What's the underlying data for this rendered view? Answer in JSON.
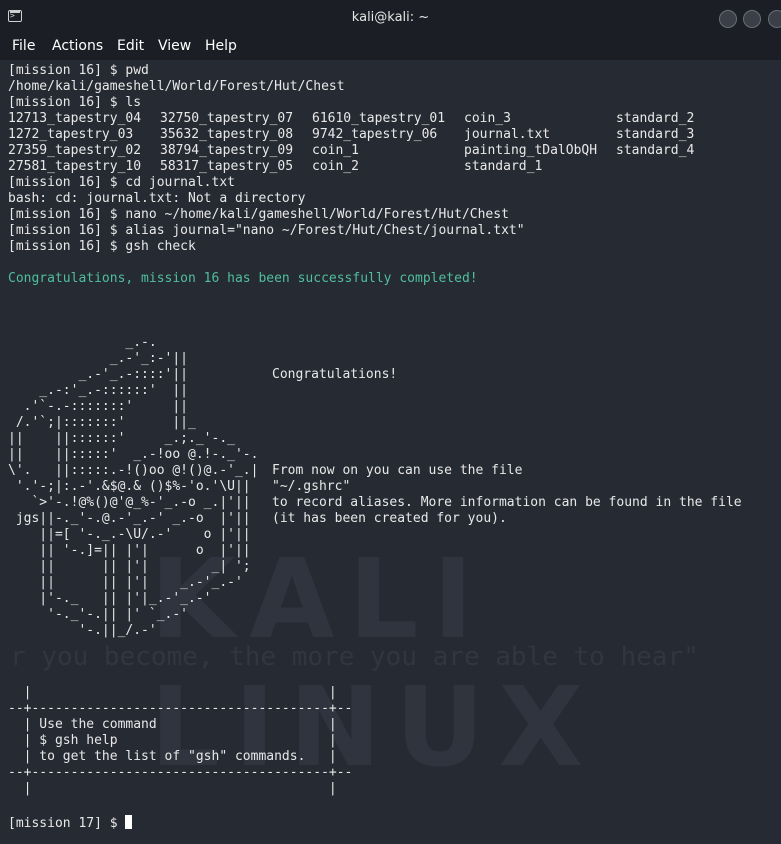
{
  "window": {
    "title": "kali@kali: ~"
  },
  "menu": [
    "File",
    "Actions",
    "Edit",
    "View",
    "Help"
  ],
  "session": [
    "[mission 16] $ pwd",
    "/home/kali/gameshell/World/Forest/Hut/Chest",
    "[mission 16] $ ls"
  ],
  "ls_columns": [
    [
      "12713_tapestry_04",
      "1272_tapestry_03",
      "27359_tapestry_02",
      "27581_tapestry_10"
    ],
    [
      "32750_tapestry_07",
      "35632_tapestry_08",
      "38794_tapestry_09",
      "58317_tapestry_05"
    ],
    [
      "61610_tapestry_01",
      "9742_tapestry_06",
      "coin_1",
      "coin_2"
    ],
    [
      "coin_3",
      "journal.txt",
      "painting_tDalObQH",
      "standard_1"
    ],
    [
      "standard_2",
      "standard_3",
      "standard_4",
      ""
    ]
  ],
  "session_after": [
    "[mission 16] $ cd journal.txt",
    "bash: cd: journal.txt: Not a directory",
    "[mission 16] $ nano ~/home/kali/gameshell/World/Forest/Hut/Chest",
    "[mission 16] $ alias journal=\"nano ~/Forest/Hut/Chest/journal.txt\"",
    "[mission 16] $ gsh check"
  ],
  "success_message": "Congratulations, mission 16 has been successfully completed!",
  "ascii_art": "               _.-.\n             _.-'_:-'||\n         _.-'_.-::::'||\n    _.-:'_.-::::::'  ||\n  .'`-.-:::::::'     ||\n /.'`;|:::::::'      ||_\n||    ||::::::'     _.;._'-._\n||    ||:::::'  _.-!oo @.!-._'-.\n\\'.   ||:::::.-!()oo @!()@.-'_.|\n '.'-;|:.-'.&$@.& ()$%-'o.'\\U||\n   `>'-.!@%()@'@_%-'_.-o _.|'||\n jgs||-._'-.@.-'_.-' _.-o  |'||\n    ||=[ '-._.-\\U/.-'    o |'||\n    || '-.]=|| |'|      o  |'||\n    ||      || |'|        _| ';\n    ||      || |'|    _.-'_.-'\n    |'-._   || |'|_.-'_.-'\n     '-._'-.|| |' `_.-'\n         '-.||_/.-'",
  "congrats": {
    "title": "Congratulations!",
    "body": "From now on you can use the file\n\"~/.gshrc\"\nto record aliases. More information can be found in the file\n(it has been created for you)."
  },
  "help_box": "  |                                      |\n--+--------------------------------------+--\n  | Use the command                      |\n  | $ gsh help                           |\n  | to get the list of \"gsh\" commands.   |\n--+--------------------------------------+--\n  |                                      |",
  "prompt": "[mission 17] $ ",
  "wallpaper": {
    "brand": "KALI LINUX",
    "quote": "r you become, the more you are able to hear\""
  },
  "colors": {
    "background": "#262a33",
    "text": "#e8e8e8",
    "success": "#4fbfa0"
  }
}
